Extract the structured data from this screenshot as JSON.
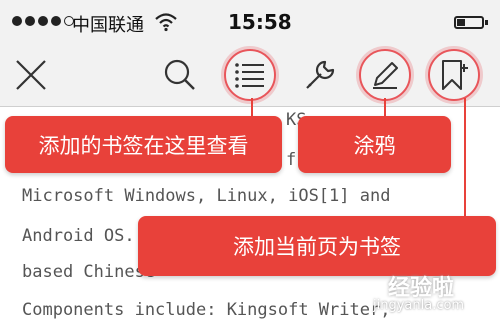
{
  "status": {
    "carrier": "中国联通",
    "time": "15:58"
  },
  "toolbar": {
    "close": "close-icon",
    "search": "search-icon",
    "bookmarks_list": "list-icon",
    "tools": "wrench-icon",
    "doodle": "pencil-icon",
    "add_bookmark": "bookmark-add-icon"
  },
  "document": {
    "line1": "Microsoft Windows, Linux, iOS[1] and",
    "line2": "Android OS.",
    "line3": "based Chinese",
    "line4": "Components include: Kingsoft Writer,",
    "line_top_partial": "KS",
    "line_f": "f"
  },
  "callouts": {
    "view_bookmarks": "添加的书签在这里查看",
    "doodle": "涂鸦",
    "add_bookmark": "添加当前页为书签"
  },
  "watermark": {
    "title": "经验啦",
    "url": "jingyanla.com"
  },
  "colors": {
    "accent": "#e8413a",
    "ring": "#e8555a"
  }
}
